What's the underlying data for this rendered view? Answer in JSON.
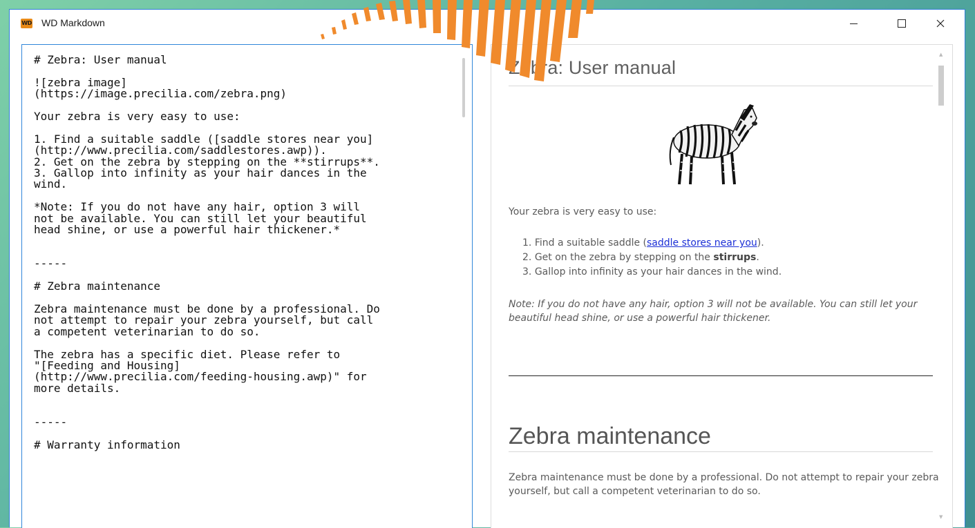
{
  "app": {
    "logo_text": "WD",
    "title": "WD Markdown"
  },
  "editor": {
    "content": "# Zebra: User manual\n\n![zebra image]\n(https://image.precilia.com/zebra.png)\n\nYour zebra is very easy to use:\n\n1. Find a suitable saddle ([saddle stores near you]\n(http://www.precilia.com/saddlestores.awp)).\n2. Get on the zebra by stepping on the **stirrups**.\n3. Gallop into infinity as your hair dances in the\nwind.\n\n*Note: If you do not have any hair, option 3 will\nnot be available. You can still let your beautiful\nhead shine, or use a powerful hair thickener.*\n\n\n-----\n\n# Zebra maintenance\n\nZebra maintenance must be done by a professional. Do\nnot attempt to repair your zebra yourself, but call\na competent veterinarian to do so.\n\nThe zebra has a specific diet. Please refer to\n\"[Feeding and Housing]\n(http://www.precilia.com/feeding-housing.awp)\" for\nmore details.\n\n\n-----\n\n# Warranty information"
  },
  "preview": {
    "h1": "Zebra: User manual",
    "intro": "Your zebra is very easy to use:",
    "list": [
      {
        "num": "1.",
        "before": "Find a suitable saddle (",
        "link": "saddle stores near you",
        "after": ")."
      },
      {
        "num": "2.",
        "before": "Get on the zebra by stepping on the ",
        "bold": "stirrups",
        "after": "."
      },
      {
        "num": "3.",
        "text": "Gallop into infinity as your hair dances in the wind."
      }
    ],
    "note": "Note: If you do not have any hair, option 3 will not be available. You can still let your beautiful head shine, or use a powerful hair thickener.",
    "h2": "Zebra maintenance",
    "maintenance": "Zebra maintenance must be done by a professional. Do not attempt to repair your zebra yourself, but call a competent veterinarian to do so."
  },
  "colors": {
    "accent_border": "#2f86d9",
    "logo_bg": "#e98a17",
    "link": "#1b2fd6",
    "deco_orange": "#f08a2c"
  }
}
